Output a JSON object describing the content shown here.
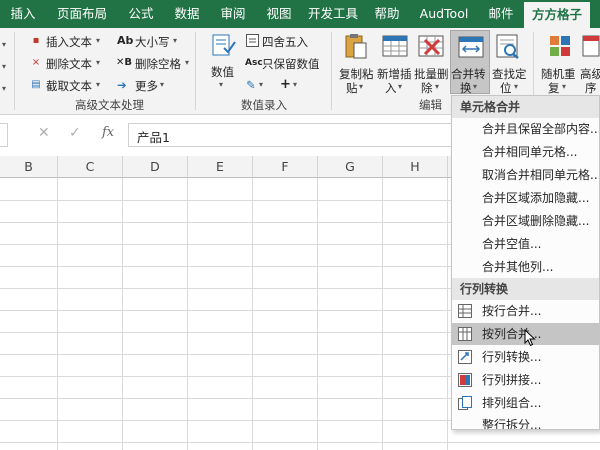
{
  "tabs": [
    {
      "label": "插入"
    },
    {
      "label": "页面布局"
    },
    {
      "label": "公式"
    },
    {
      "label": "数据"
    },
    {
      "label": "审阅"
    },
    {
      "label": "视图"
    },
    {
      "label": "开发工具"
    },
    {
      "label": "帮助"
    },
    {
      "label": "AudTool"
    },
    {
      "label": "邮件"
    },
    {
      "label": "方方格子"
    }
  ],
  "ribbon": {
    "text_group": {
      "items": [
        "插入文本",
        "删除文本",
        "截取文本",
        "大小写",
        "删除空格",
        "更多"
      ],
      "label": "高级文本处理"
    },
    "number_group": {
      "big_button": "数值",
      "items": [
        "四舍五入",
        "只保留数值"
      ],
      "label": "数值录入"
    },
    "edit_group": {
      "buttons": [
        {
          "line1": "复制粘",
          "line2": "贴"
        },
        {
          "line1": "新增插",
          "line2": "入"
        },
        {
          "line1": "批量删",
          "line2": "除"
        },
        {
          "line1": "合并转",
          "line2": "换"
        },
        {
          "line1": "查找定",
          "line2": "位"
        }
      ],
      "label": "编辑"
    },
    "more_buttons": [
      {
        "line1": "随机重",
        "line2": "复"
      },
      {
        "line1": "高级",
        "line2": "序"
      }
    ]
  },
  "formula_bar": {
    "value": "产品1",
    "fx": "fx"
  },
  "grid": {
    "columns": [
      "B",
      "C",
      "D",
      "E",
      "F",
      "G",
      "H"
    ]
  },
  "menu": {
    "section1": "单元格合并",
    "section1_items": [
      "合并且保留全部内容...",
      "合并相同单元格...",
      "取消合并相同单元格...",
      "合并区域添加隐藏...",
      "合并区域删除隐藏...",
      "合并空值...",
      "合并其他列..."
    ],
    "section2": "行列转换",
    "section2_items": [
      "按行合并...",
      "按列合并...",
      "行列转换...",
      "行列拼接...",
      "排列组合...",
      "整行拆分..."
    ]
  },
  "colors": {
    "brand": "#217346",
    "ribbon_bg": "#f3f3f3",
    "hover": "#c5c5c5"
  }
}
